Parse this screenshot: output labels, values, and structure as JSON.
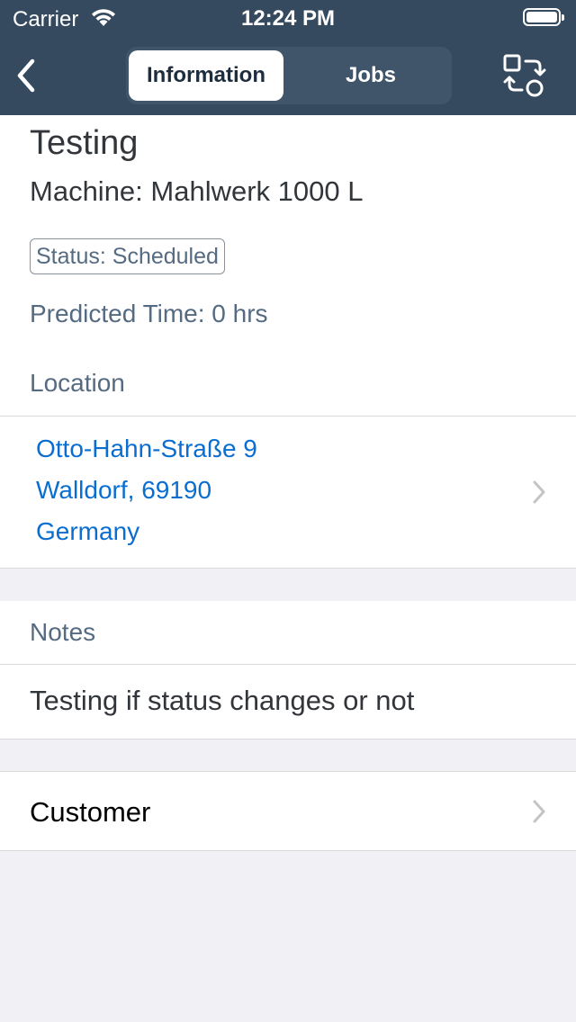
{
  "status_bar": {
    "carrier": "Carrier",
    "time": "12:24 PM",
    "wifi_icon": "wifi-icon",
    "battery_icon": "battery-icon"
  },
  "nav": {
    "back_icon": "chevron-left-icon",
    "tabs": [
      {
        "label": "Information",
        "selected": true
      },
      {
        "label": "Jobs",
        "selected": false
      }
    ],
    "action_icon": "swap-shapes-icon",
    "bar_color": "#354a5f"
  },
  "header": {
    "title": "Testing",
    "machine": "Machine: Mahlwerk 1000 L",
    "status": "Status: Scheduled",
    "predicted_time": "Predicted Time: 0 hrs"
  },
  "location": {
    "label": "Location",
    "street": "Otto-Hahn-Straße 9",
    "city": "Walldorf, 69190",
    "country": "Germany",
    "link_color": "#0a6ed1"
  },
  "notes": {
    "label": "Notes",
    "text": "Testing if status changes or not"
  },
  "customer": {
    "label": "Customer"
  }
}
